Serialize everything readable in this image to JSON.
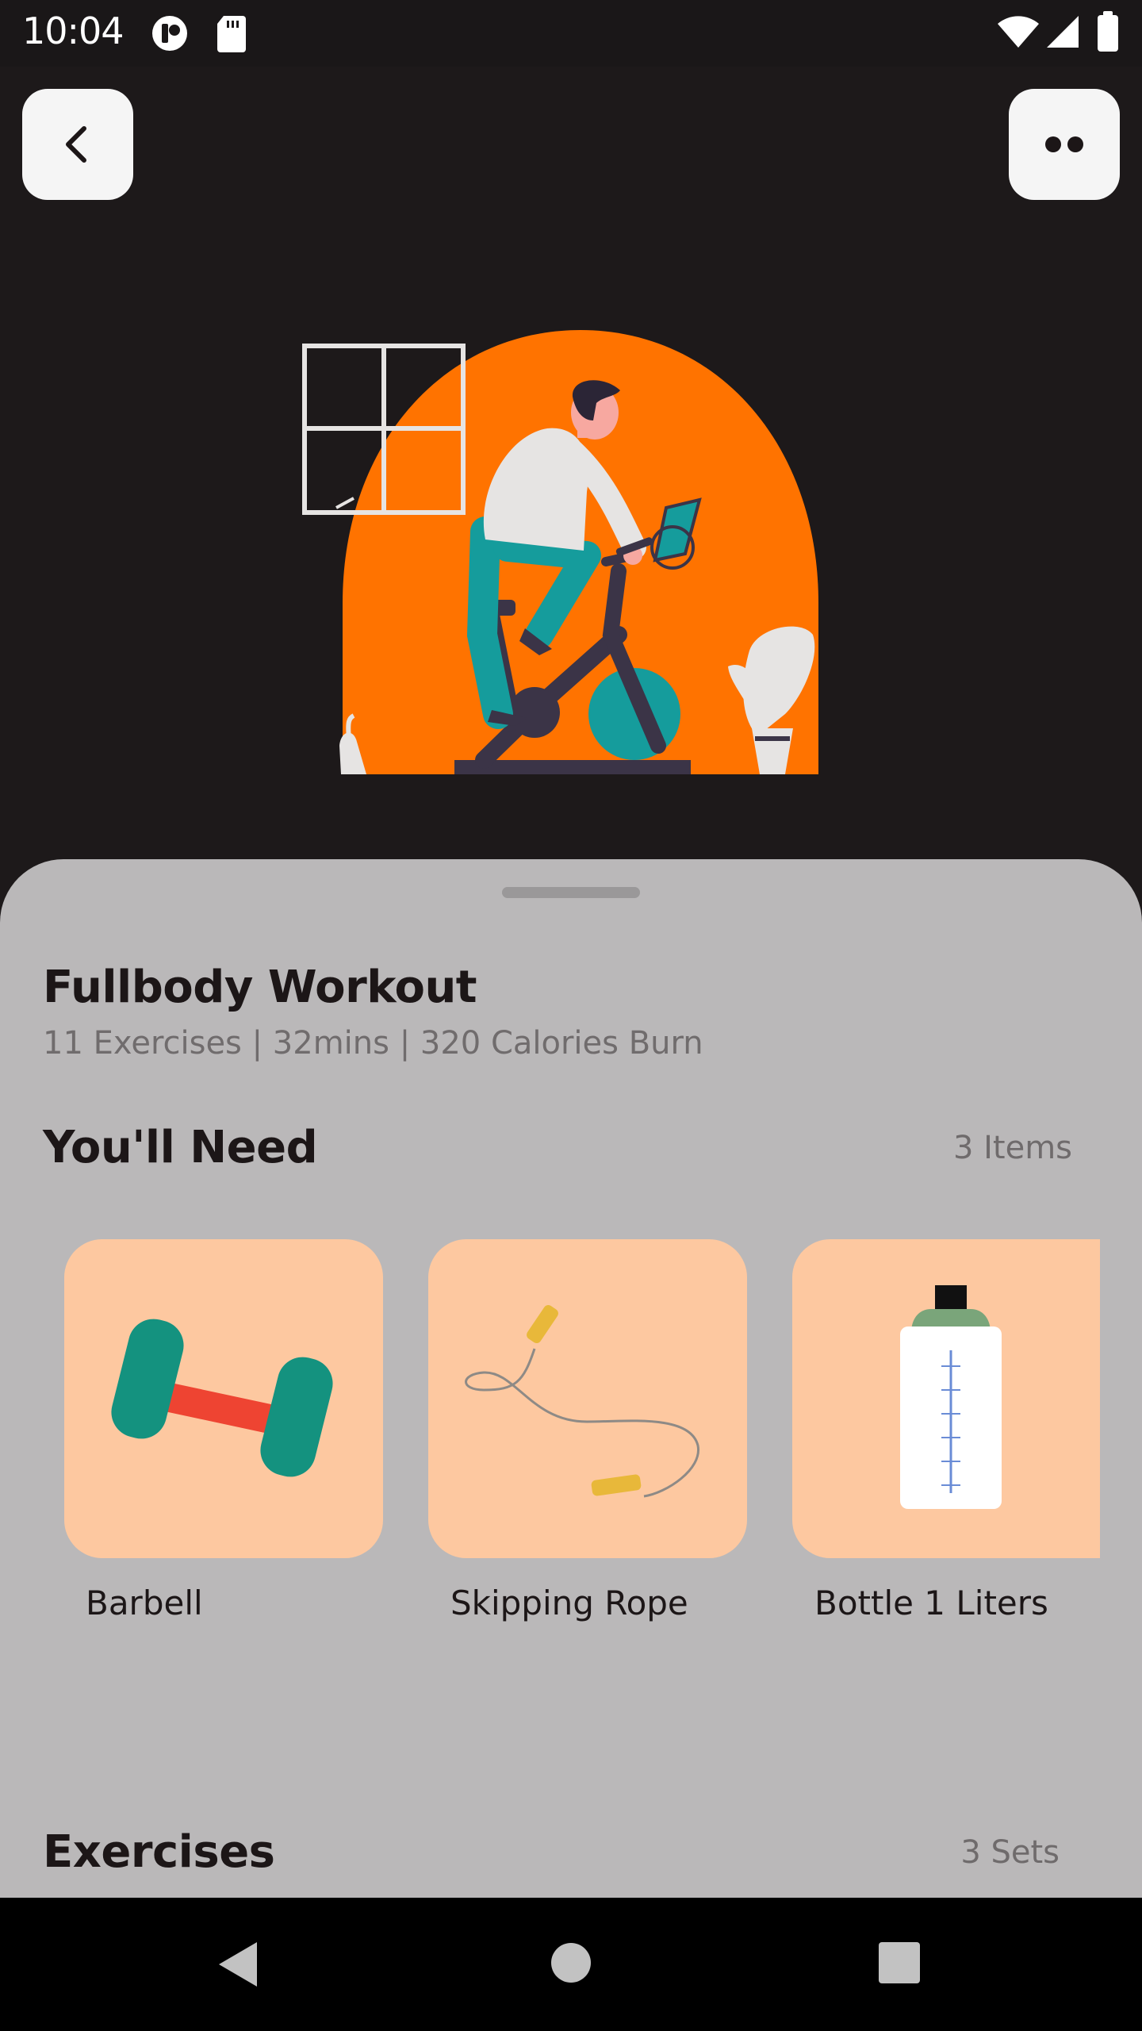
{
  "status_bar": {
    "time": "10:04"
  },
  "top_bar": {
    "back_icon": "chevron-left-icon",
    "more_icon": "more-dots-icon"
  },
  "workout": {
    "title": "Fullbody Workout",
    "subtitle": "11 Exercises | 32mins | 320 Calories Burn"
  },
  "needs": {
    "title": "You'll Need",
    "count": "3 Items",
    "items": [
      {
        "label": "Barbell",
        "icon": "dumbbell-icon"
      },
      {
        "label": "Skipping Rope",
        "icon": "skipping-rope-icon"
      },
      {
        "label": "Bottle 1 Liters",
        "icon": "water-bottle-icon"
      }
    ]
  },
  "exercises": {
    "title": "Exercises",
    "count": "3 Sets"
  },
  "colors": {
    "accent_orange": "#ff7300",
    "card_peach": "#fdc8a0",
    "sheet_gray": "#bab8b9",
    "background": "#1d191a"
  }
}
